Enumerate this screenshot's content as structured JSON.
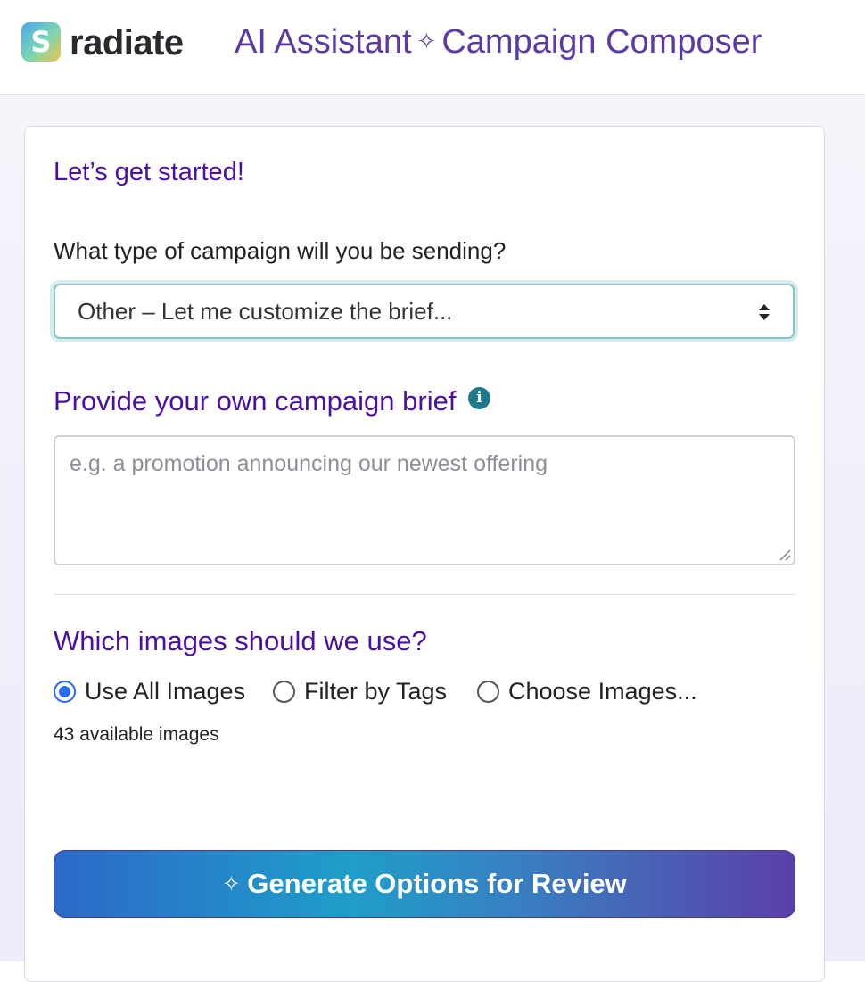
{
  "header": {
    "logo_letter": "S",
    "brand": "radiate",
    "title_left": "AI Assistant",
    "title_right": "Campaign Composer",
    "sparkle": "✧"
  },
  "form": {
    "heading": "Let’s get started!",
    "campaign_type_label": "What type of campaign will you be sending?",
    "campaign_type_selected": "Other – Let me customize the brief...",
    "brief_heading": "Provide your own campaign brief",
    "brief_placeholder": "e.g. a promotion announcing our newest offering",
    "images_heading": "Which images should we use?",
    "image_options": [
      {
        "label": "Use All Images",
        "checked": true
      },
      {
        "label": "Filter by Tags",
        "checked": false
      },
      {
        "label": "Choose Images...",
        "checked": false
      }
    ],
    "available_images": "43 available images",
    "generate_label": "Generate Options for Review"
  },
  "icons": {
    "info": "info-icon",
    "sparkle": "sparkle-icon",
    "select_arrows": "select-arrows-icon"
  },
  "colors": {
    "accent_purple": "#4b0fa3",
    "title_purple": "#5b3aa6",
    "radio_blue": "#2a6df4",
    "info_teal": "#1f7a8c"
  }
}
